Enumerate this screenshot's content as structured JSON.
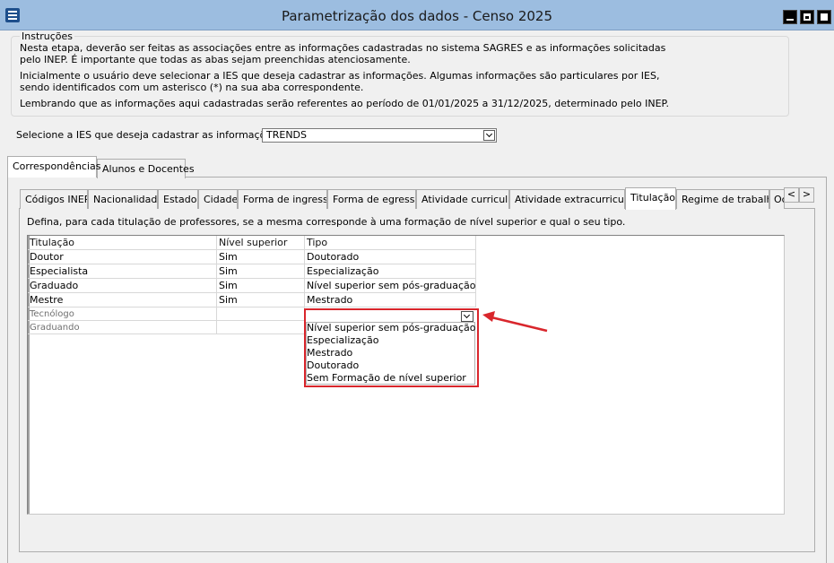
{
  "window": {
    "title": "Parametrização dos dados - Censo 2025"
  },
  "instructions": {
    "legend": "Instruções",
    "lines": [
      "Nesta etapa, deverão ser feitas as associações entre as informações cadastradas no sistema SAGRES e as informações solicitadas",
      "pelo INEP. É importante que todas as abas sejam preenchidas atenciosamente.",
      "Inicialmente o usuário deve selecionar a IES que deseja cadastrar as informações. Algumas informações são particulares por IES,",
      "sendo identificados com um asterisco (*) na sua aba correspondente.",
      "Lembrando que as informações aqui cadastradas serão referentes ao período de 01/01/2025 a 31/12/2025, determinado pelo INEP."
    ]
  },
  "ies": {
    "label": "Selecione a IES que deseja cadastrar as informações:",
    "selected": "TRENDS"
  },
  "outer_tabs": [
    "Correspondências",
    "Alunos e Docentes"
  ],
  "inner_tabs": [
    "Códigos INEP",
    "Nacionalidade",
    "Estado",
    "Cidade",
    "Forma de ingresso",
    "Forma de egresso",
    "Atividade curricular",
    "Atividade extracurricular",
    "Titulação",
    "Regime de trabalho",
    "Oc"
  ],
  "scroll_buttons": {
    "left": "<",
    "right": ">"
  },
  "panel": {
    "description": "Defina, para cada titulação de professores, se a mesma corresponde à uma formação de nível superior e qual o seu tipo."
  },
  "grid": {
    "columns": [
      "Titulação",
      "Nível superior",
      "Tipo"
    ],
    "rows": [
      [
        "Doutor",
        "Sim",
        "Doutorado"
      ],
      [
        "Especialista",
        "Sim",
        "Especialização"
      ],
      [
        "Graduado",
        "Sim",
        "Nível superior sem pós-graduação"
      ],
      [
        "Mestre",
        "Sim",
        "Mestrado"
      ],
      [
        "Tecnólogo",
        "",
        ""
      ],
      [
        "Graduando",
        "",
        ""
      ]
    ]
  },
  "tipo_dropdown": {
    "options": [
      "Nível superior sem pós-graduação",
      "Especialização",
      "Mestrado",
      "Doutorado",
      "Sem Formação de nível superior"
    ]
  },
  "colors": {
    "titlebar": "#9cbde0",
    "highlight": "#d9262c"
  }
}
